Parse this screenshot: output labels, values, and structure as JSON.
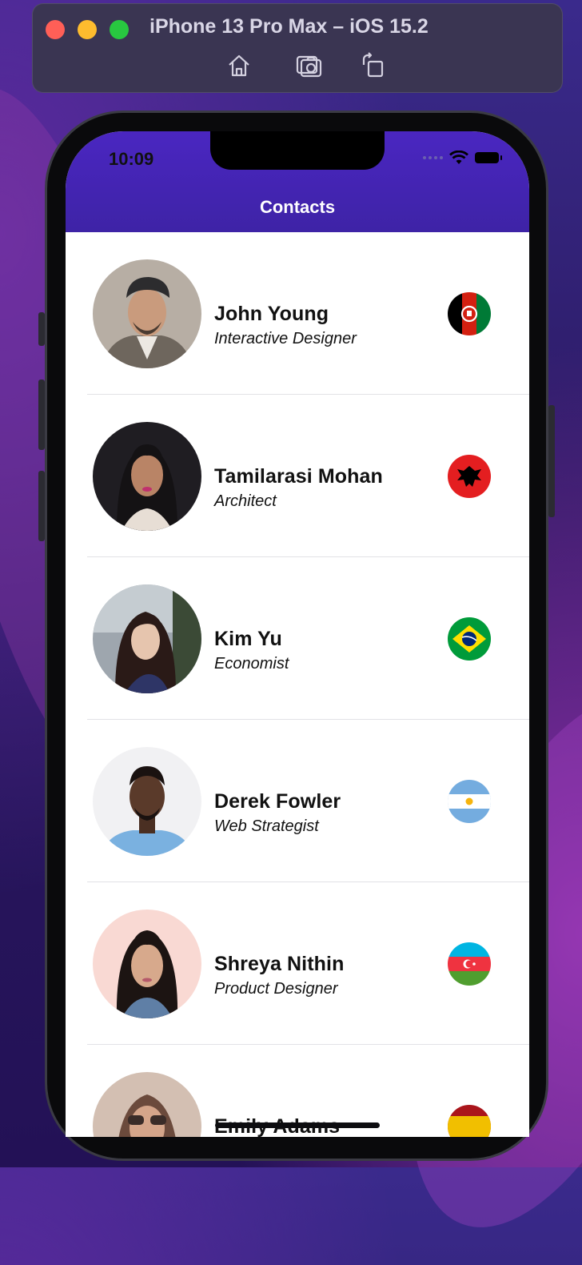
{
  "simulator": {
    "title": "iPhone 13 Pro Max – iOS 15.2",
    "tools": [
      "home-icon",
      "screenshot-icon",
      "rotate-icon"
    ]
  },
  "status_bar": {
    "time": "10:09"
  },
  "nav": {
    "title": "Contacts"
  },
  "contacts": [
    {
      "name": "John Young",
      "title": "Interactive Designer",
      "flag": "Afghanistan"
    },
    {
      "name": "Tamilarasi Mohan",
      "title": "Architect",
      "flag": "Albania"
    },
    {
      "name": "Kim Yu",
      "title": "Economist",
      "flag": "Brazil"
    },
    {
      "name": "Derek Fowler",
      "title": "Web Strategist",
      "flag": "Argentina"
    },
    {
      "name": "Shreya Nithin",
      "title": "Product Designer",
      "flag": "Azerbaijan"
    },
    {
      "name": "Emily Adams",
      "title": "",
      "flag": "Spain"
    }
  ],
  "colors": {
    "header": "#4a26c1",
    "separator": "#e2e2e6"
  }
}
